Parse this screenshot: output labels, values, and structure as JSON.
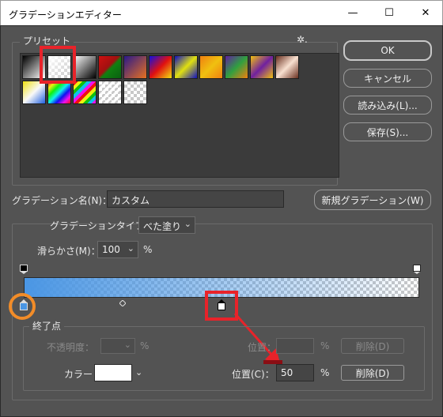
{
  "window": {
    "title": "グラデーションエディター",
    "minimize_glyph": "—",
    "maximize_glyph": "☐",
    "close_glyph": "✕"
  },
  "presets": {
    "label": "プリセット",
    "settings_icon": "gear-icon",
    "settings_glyph": "✲."
  },
  "buttons": {
    "ok": "OK",
    "cancel": "キャンセル",
    "load": "読み込み(L)...",
    "save": "保存(S)..."
  },
  "gradient_name": {
    "label": "グラデーション名(N)：",
    "value": "カスタム",
    "new_button": "新規グラデーション(W)"
  },
  "gradient_type": {
    "label": "グラデーションタイプ：",
    "value": "べた塗り"
  },
  "smoothness": {
    "label": "滑らかさ(M)：",
    "value": "100",
    "unit": "%"
  },
  "stops": {
    "group_title": "終了点",
    "opacity_label": "不透明度：",
    "opacity_unit": "%",
    "opacity_location_label": "位置：",
    "opacity_location_unit": "%",
    "opacity_delete": "削除(D)",
    "color_label": "カラー：",
    "color_value": "#ffffff",
    "location_label": "位置(C)：",
    "location_value": "50",
    "location_unit": "%",
    "delete": "削除(D)"
  },
  "colors": {
    "dialog_bg": "#535353",
    "gradient_start": "#4a96e4",
    "annotation_red": "#e8232a",
    "annotation_orange": "#f28c28"
  }
}
